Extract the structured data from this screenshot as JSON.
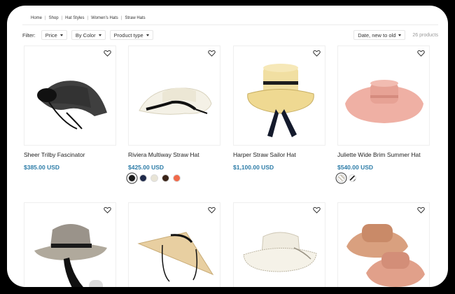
{
  "breadcrumb": [
    "Home",
    "Shop",
    "Hat Styles",
    "Women's Hats",
    "Straw Hats"
  ],
  "filters": {
    "label": "Filter:",
    "price": "Price",
    "color": "By Color",
    "type": "Product type",
    "sort": "Date, new to old",
    "count": "26 products"
  },
  "products": [
    {
      "name": "Sheer Trilby Fascinator",
      "price": "$385.00 USD"
    },
    {
      "name": "Riviera Multiway Straw Hat",
      "price": "$425.00 USD",
      "swatches": [
        "#1a1a1a",
        "#1f2a4a",
        "#e8e4d6",
        "#3a2418",
        "#f06a4a"
      ]
    },
    {
      "name": "Harper Straw Sailor Hat",
      "price": "$1,100.00 USD"
    },
    {
      "name": "Juliette Wide Brim Summer Hat",
      "price": "$540.00 USD"
    },
    {
      "name": "",
      "price": ""
    },
    {
      "name": "",
      "price": ""
    },
    {
      "name": "",
      "price": ""
    },
    {
      "name": "",
      "price": ""
    }
  ],
  "colors": {
    "accent": "#2e7da8"
  }
}
